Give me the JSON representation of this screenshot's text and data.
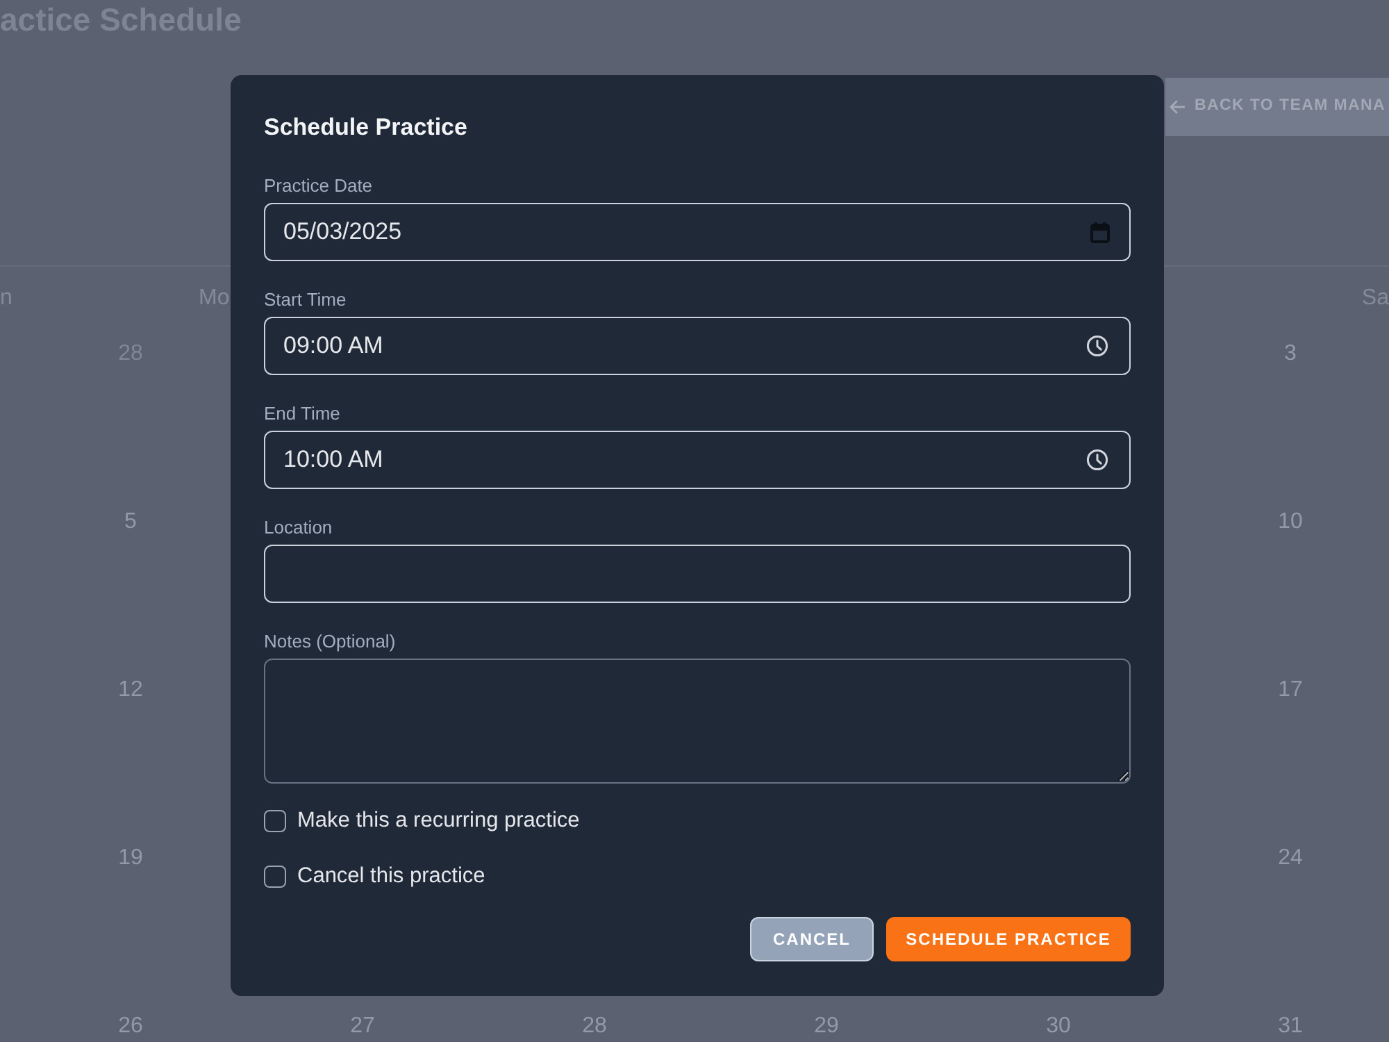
{
  "page": {
    "title": "actice Schedule",
    "back_button": {
      "label": "BACK TO TEAM MANA"
    }
  },
  "calendar": {
    "weekdays": [
      "n",
      "Mo",
      "Sa"
    ],
    "weeks": [
      [
        {
          "day": "28",
          "outside_month": true
        },
        {
          "day": "3",
          "outside_month": false
        }
      ],
      [
        {
          "day": "5",
          "outside_month": false
        },
        {
          "day": "10",
          "outside_month": false
        }
      ],
      [
        {
          "day": "12",
          "outside_month": false
        },
        {
          "day": "17",
          "outside_month": false
        }
      ],
      [
        {
          "day": "19",
          "outside_month": false
        },
        {
          "day": "24",
          "outside_month": false
        }
      ],
      [
        {
          "day": "26",
          "outside_month": false
        },
        {
          "day": "27",
          "outside_month": false
        },
        {
          "day": "28",
          "outside_month": false
        },
        {
          "day": "29",
          "outside_month": false
        },
        {
          "day": "30",
          "outside_month": false
        },
        {
          "day": "31",
          "outside_month": false
        }
      ]
    ]
  },
  "modal": {
    "title": "Schedule Practice",
    "fields": [
      {
        "kind": "date",
        "label": "Practice Date",
        "value": "05/03/2025"
      },
      {
        "kind": "time",
        "label": "Start Time",
        "value": "09:00 AM"
      },
      {
        "kind": "time",
        "label": "End Time",
        "value": "10:00 AM"
      },
      {
        "kind": "text",
        "label": "Location"
      },
      {
        "kind": "textarea",
        "label": "Notes (Optional)"
      }
    ],
    "checkboxes": [
      {
        "label": "Make this a recurring practice",
        "checked": false
      },
      {
        "label": "Cancel this practice",
        "checked": false
      }
    ],
    "buttons": [
      {
        "kind": "secondary",
        "label": "CANCEL"
      },
      {
        "kind": "primary",
        "label": "SCHEDULE PRACTICE"
      }
    ]
  }
}
